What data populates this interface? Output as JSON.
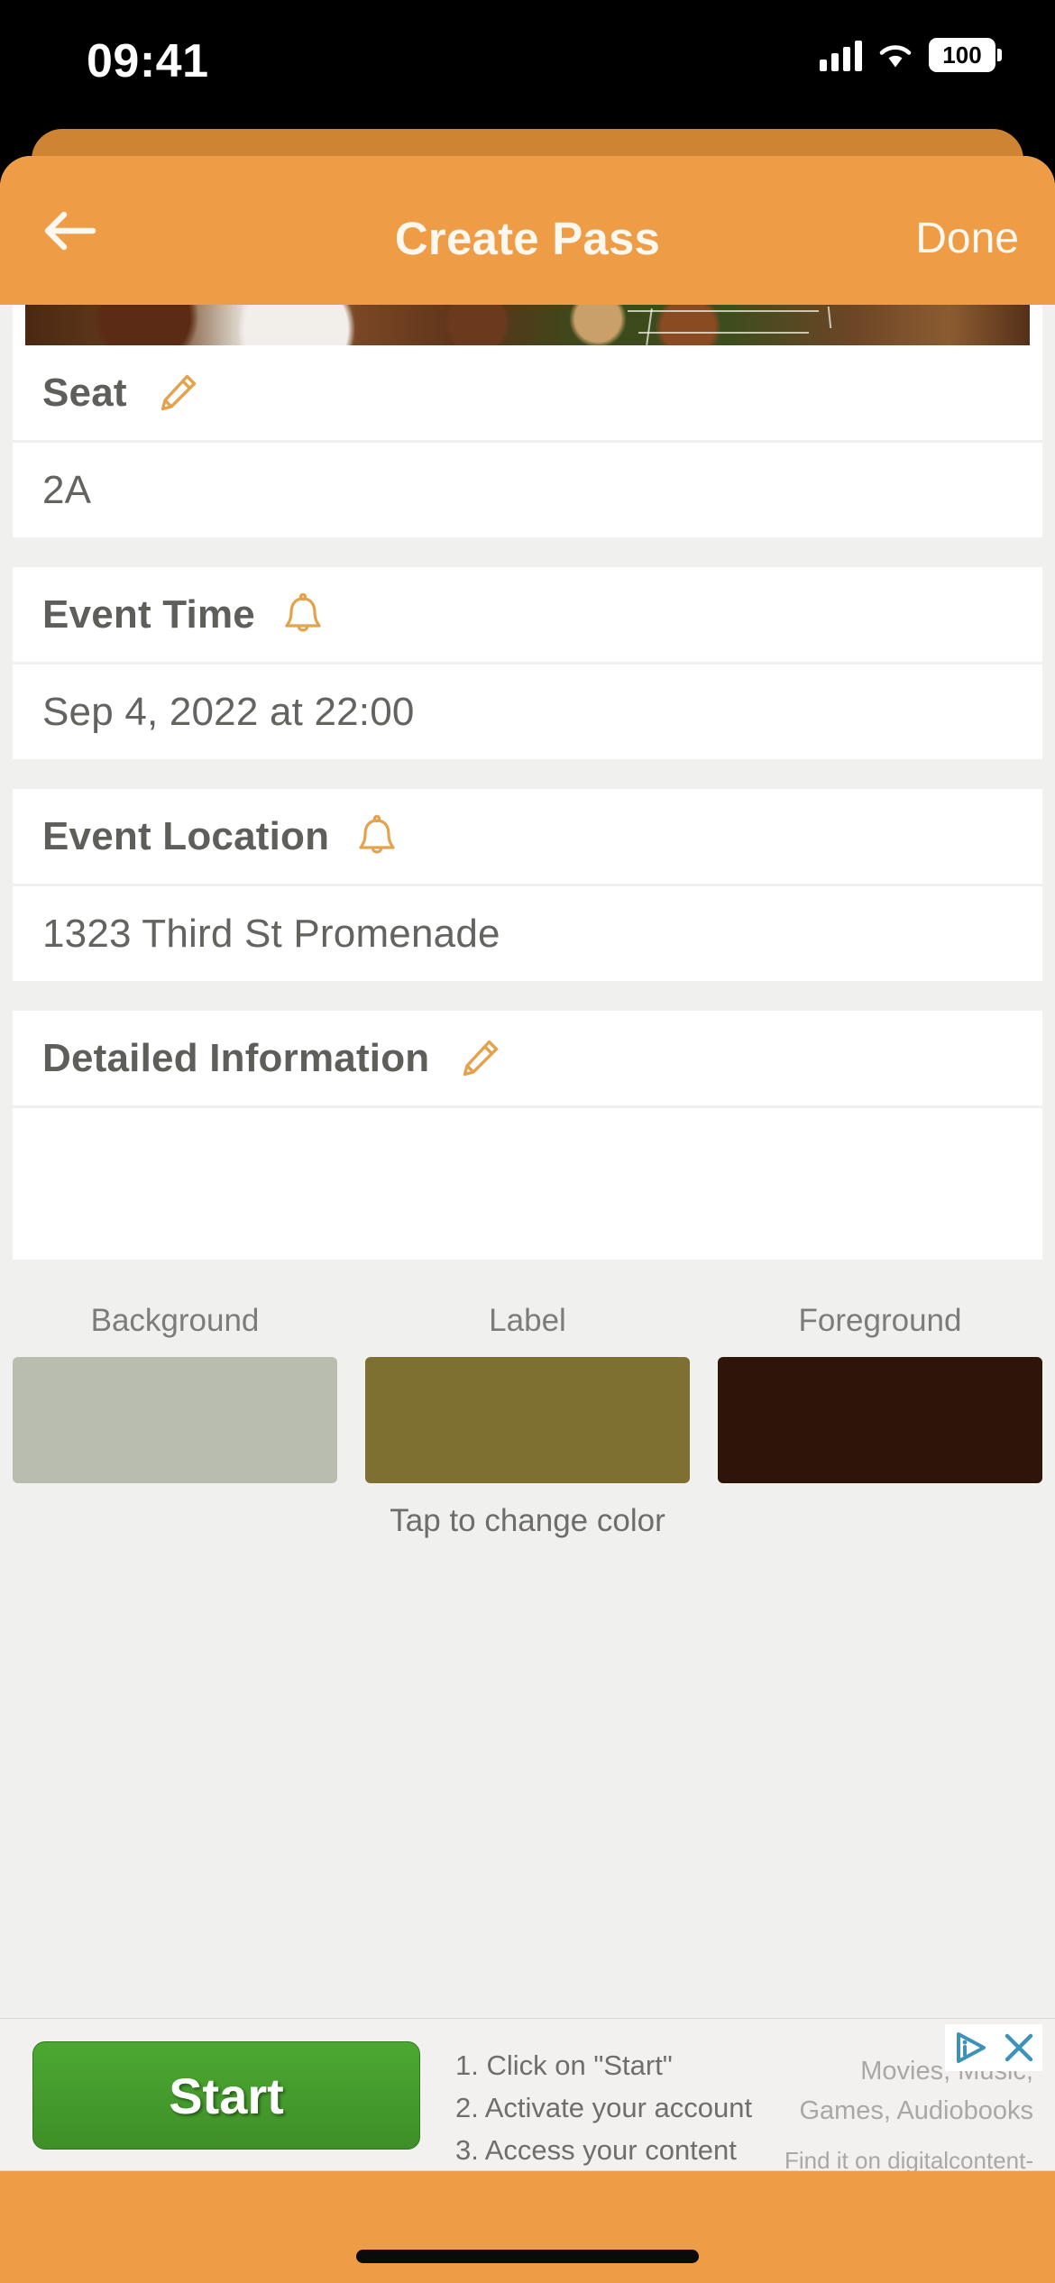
{
  "status_bar": {
    "time": "09:41",
    "battery_level": "100",
    "cellular_icon": "signal-bars-icon",
    "wifi_icon": "wifi-icon",
    "battery_icon": "battery-icon"
  },
  "nav": {
    "back_icon": "arrow-left-icon",
    "title": "Create Pass",
    "done_label": "Done"
  },
  "hero": {
    "image_alt": "stadium-tennis-court-photo"
  },
  "fields": [
    {
      "key": "seat",
      "label": "Seat",
      "icon": "pencil-icon",
      "value": "2A"
    },
    {
      "key": "event_time",
      "label": "Event Time",
      "icon": "bell-icon",
      "value": "Sep 4, 2022 at 22:00"
    },
    {
      "key": "event_location",
      "label": "Event Location",
      "icon": "bell-icon",
      "value": "1323 Third St Promenade"
    },
    {
      "key": "detailed_information",
      "label": "Detailed Information",
      "icon": "pencil-icon",
      "value": ""
    }
  ],
  "colors_section": {
    "hint": "Tap to change color",
    "swatches": [
      {
        "label": "Background",
        "color": "#B8BDB0"
      },
      {
        "label": "Label",
        "color": "#7E7030"
      },
      {
        "label": "Foreground",
        "color": "#2E1409"
      }
    ]
  },
  "ad": {
    "start_label": "Start",
    "steps": "1. Click on \"Start\"\n2. Activate your account\n3. Access your content",
    "step_1": "1. Click on \"Start\"",
    "step_2": "2. Activate your account",
    "step_3": "3. Access your content",
    "promo_line_1": "Movies, Music,",
    "promo_line_2": "Games, Audiobooks",
    "promo_line_3": "Find it on digitalcontent-unlimited",
    "adchoices_icon": "adchoices-info-icon",
    "close_icon": "close-x-icon"
  },
  "theme": {
    "accent_orange": "#EF9C46",
    "accent_orange_dark": "#CE8433",
    "page_bg": "#F0F0EE",
    "card_bg": "#FFFFFF",
    "label_text": "#5E5E5B",
    "value_text": "#636360",
    "icon_orange": "#E5A24C",
    "ad_green": "#4CA832"
  },
  "home_indicator": "home-indicator"
}
